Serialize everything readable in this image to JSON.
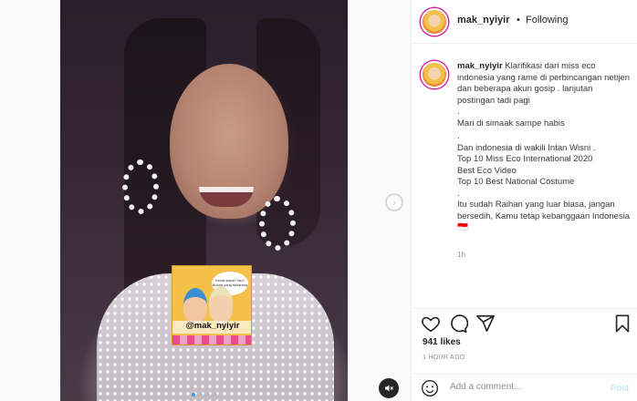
{
  "post": {
    "username": "mak_nyiyir",
    "separator": "•",
    "follow_status": "Following",
    "caption_lines": [
      "Klarifikasi dari miss eco indonesia yang rame di perbincangan netijen dan beberapa akun gosip . lanjutan postingan tadi pagi",
      ".",
      "Mari di simaak sampe habis",
      ".",
      "Dan indonesia di wakili Intan Wisni .",
      "Top 10 Miss Eco International 2020",
      "Best Eco Video",
      "Top 10 Best National Costume",
      ".",
      "Itu sudah Raihan yang luar biasa, jangan bersedih, Kamu tetap kebanggaan Indonesia 🇮🇩"
    ],
    "caption_time": "1h",
    "likes": "941 likes",
    "time_ago": "1 HOUR AGO"
  },
  "media": {
    "sticker_handle": "@mak_nyiyir",
    "sticker_bubble": "Kenal siapa? tau? Bukan yang sekarang",
    "carousel_count": 4,
    "carousel_active": 0
  },
  "comment": {
    "placeholder": "Add a comment…",
    "post_label": "Post"
  },
  "icons": {
    "like": "heart-icon",
    "comment": "comment-icon",
    "share": "share-icon",
    "save": "bookmark-icon",
    "emoji": "emoji-icon",
    "mute": "muted-speaker-icon",
    "next": "chevron-right-icon"
  },
  "colors": {
    "accent_link": "#b2dffc",
    "carousel_active_dot": "#3a9cf0",
    "text_primary": "#262626",
    "text_secondary": "#8e8e8e"
  }
}
